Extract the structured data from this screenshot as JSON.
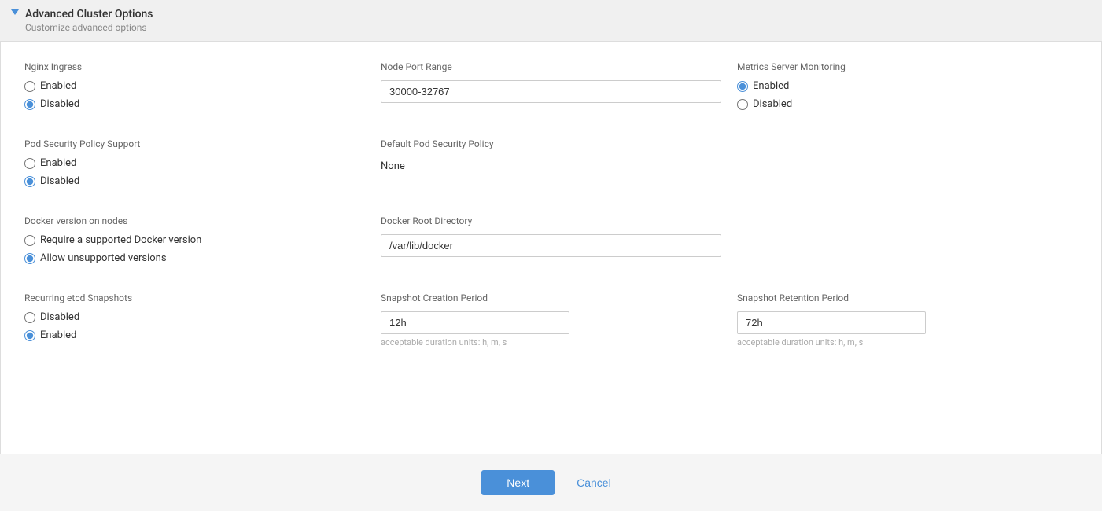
{
  "panel": {
    "title": "Advanced Cluster Options",
    "subtitle": "Customize advanced options"
  },
  "sections": {
    "nginx_ingress": {
      "label": "Nginx Ingress",
      "options": [
        {
          "label": "Enabled",
          "value": "enabled",
          "checked": false
        },
        {
          "label": "Disabled",
          "value": "disabled",
          "checked": true
        }
      ]
    },
    "node_port_range": {
      "label": "Node Port Range",
      "value": "30000-32767",
      "placeholder": ""
    },
    "metrics_server": {
      "label": "Metrics Server Monitoring",
      "options": [
        {
          "label": "Enabled",
          "value": "enabled",
          "checked": true
        },
        {
          "label": "Disabled",
          "value": "disabled",
          "checked": false
        }
      ]
    },
    "pod_security_policy": {
      "label": "Pod Security Policy Support",
      "options": [
        {
          "label": "Enabled",
          "value": "enabled",
          "checked": false
        },
        {
          "label": "Disabled",
          "value": "disabled",
          "checked": true
        }
      ]
    },
    "default_pod_security": {
      "label": "Default Pod Security Policy",
      "value": "None"
    },
    "docker_version": {
      "label": "Docker version on nodes",
      "options": [
        {
          "label": "Require a supported Docker version",
          "value": "require",
          "checked": false
        },
        {
          "label": "Allow unsupported versions",
          "value": "allow",
          "checked": true
        }
      ]
    },
    "docker_root": {
      "label": "Docker Root Directory",
      "value": "/var/lib/docker"
    },
    "recurring_etcd": {
      "label": "Recurring etcd Snapshots",
      "options": [
        {
          "label": "Disabled",
          "value": "disabled",
          "checked": false
        },
        {
          "label": "Enabled",
          "value": "enabled",
          "checked": true
        }
      ]
    },
    "snapshot_creation": {
      "label": "Snapshot Creation Period",
      "value": "12h",
      "hint": "acceptable duration units: h, m, s"
    },
    "snapshot_retention": {
      "label": "Snapshot Retention Period",
      "value": "72h",
      "hint": "acceptable duration units: h, m, s"
    }
  },
  "footer": {
    "next_label": "Next",
    "cancel_label": "Cancel"
  }
}
